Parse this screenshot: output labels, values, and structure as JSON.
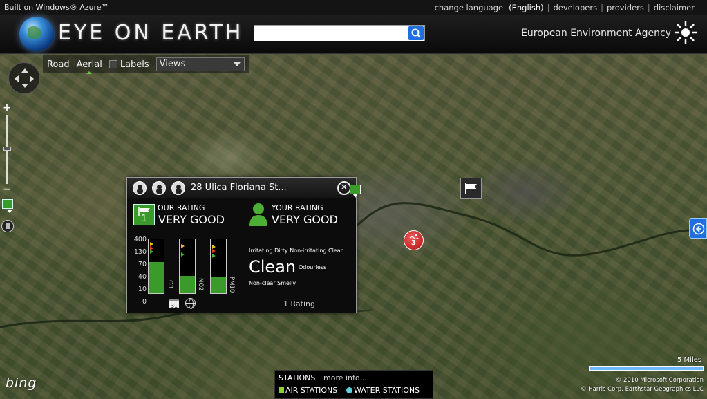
{
  "topbar": {
    "built": "Built on Windows® Azure™",
    "links": [
      "change language",
      "(English)",
      "developers",
      "providers",
      "disclaimer"
    ]
  },
  "header": {
    "logo": "EYE ON EARTH",
    "search_value": "",
    "agency": "European Environment Agency"
  },
  "toolbar": {
    "road": "Road",
    "aerial": "Aerial",
    "labels": "Labels",
    "views": "Views"
  },
  "zoom": {
    "plus": "+",
    "minus": "−"
  },
  "popup": {
    "title": "28 Ulica Floriana St...",
    "close": "✕",
    "our": {
      "count": "1",
      "label": "OUR RATING",
      "value": "VERY GOOD"
    },
    "your": {
      "label": "YOUR RATING",
      "value": "VERY GOOD"
    },
    "ticks": [
      "400",
      "130",
      "70",
      "40",
      "10",
      "0"
    ],
    "bars": [
      {
        "name": "O3",
        "fill_fraction": 0.58
      },
      {
        "name": "NO2",
        "fill_fraction": 0.32
      },
      {
        "name": "PM10",
        "fill_fraction": 0.3
      }
    ],
    "calendar": "31",
    "words_row1": "Irritating  Dirty  Non-irritating  Clear",
    "clean": "Clean",
    "odourless": "Odourless",
    "words_row3": "Non-clear  Smelly",
    "rating_count": "1 Rating"
  },
  "markers": {
    "water_number": "3"
  },
  "bottom": {
    "bing": "bing",
    "stations_title": "STATIONS",
    "more_info": "more info...",
    "air": "AIR STATIONS",
    "water": "WATER STATIONS",
    "scale": "5 Miles",
    "copyright1": "© 2010 Microsoft Corporation",
    "copyright2": "© Harris Corp, Earthstar Geographics LLC"
  },
  "colors": {
    "accent_green": "#3a9b2a",
    "bing_blue": "#1f6fe0",
    "water_marker": "#c41a1a"
  }
}
